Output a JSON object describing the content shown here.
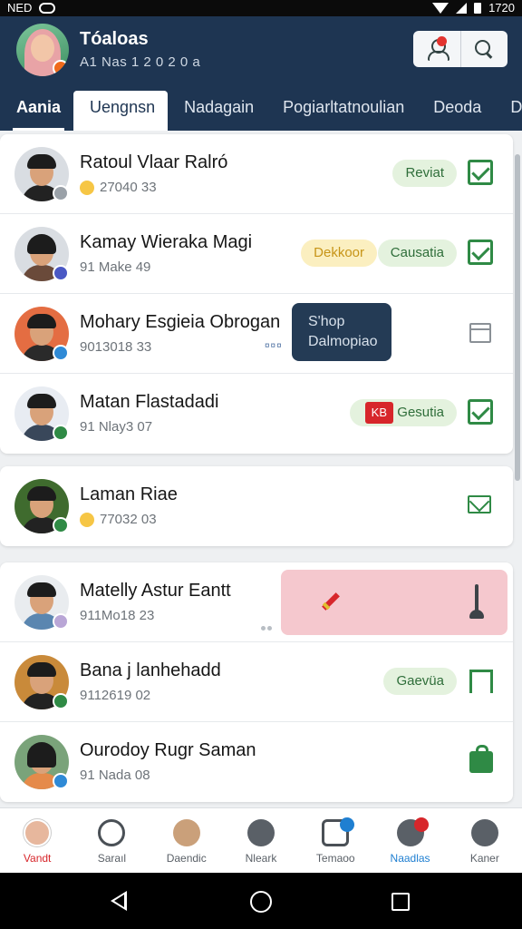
{
  "status_bar": {
    "left_text": "NED",
    "time": "1720"
  },
  "header": {
    "title": "Tóaloas",
    "subtitle": "A1 Nas 1 2 0 2 0 a",
    "tabs": [
      {
        "label": "Aania",
        "active": true
      },
      {
        "label": "Uengnsn",
        "selected": true
      },
      {
        "label": "Nadagain"
      },
      {
        "label": "Pogiarltatnoulian"
      },
      {
        "label": "Deoda"
      },
      {
        "label": "Dati"
      }
    ]
  },
  "tooltip": {
    "line1": "S'hop",
    "line2": "Dalmopiao",
    "mark": "¤¤¤"
  },
  "contacts_group_1": [
    {
      "name": "Ratoul Vlaar Ralró",
      "meta": "27040 33",
      "emoji": true,
      "chip": "Reviat",
      "badge_color": "#9aa1a8",
      "action": "check"
    },
    {
      "name": "Kamay Wieraka Magi",
      "meta": "91 Make 49",
      "chip_yellow": "Dekkoor",
      "chip": "Causatia",
      "badge_color": "#4a58c4",
      "action": "check"
    },
    {
      "name": "Mohary Esgieia Obrogan",
      "meta": "9013018 33",
      "badge_color": "#2f8ad6",
      "action": "box"
    },
    {
      "name": "Matan Flastadadi",
      "meta": "91 Nlay3 07",
      "chip_red": "KB",
      "chip": "Gesutia",
      "badge_color": "#2f8a45",
      "action": "check"
    }
  ],
  "contacts_group_2": [
    {
      "name": "Laman Riae",
      "meta": "77032 03",
      "emoji": true,
      "badge_color": "#2f8a45",
      "action": "mail"
    }
  ],
  "contacts_group_3": [
    {
      "name": "Matelly Astur Eantt",
      "meta": "911Mo18 23",
      "badge_color": "#b9a6d6",
      "action": "pink"
    },
    {
      "name": "Bana j lanhehadd",
      "meta": "9112619 02",
      "chip": "Gaevüa",
      "badge_color": "#2f8a45",
      "action": "halfbox"
    },
    {
      "name": "Ourodoy Rugr Saman",
      "meta": "91 Nada 08",
      "badge_color": "#2f8ad6",
      "action": "lock"
    }
  ],
  "bottom_nav": [
    {
      "label": "Vandt",
      "icon": "avatar-icon",
      "state": "active"
    },
    {
      "label": "Saraıl",
      "icon": "chat-bubble-icon"
    },
    {
      "label": "Daendic",
      "icon": "contact-photo-icon"
    },
    {
      "label": "Nleark",
      "icon": "check-circle-icon"
    },
    {
      "label": "Temaoo",
      "icon": "media-icon",
      "badge": "#1f7fd1"
    },
    {
      "label": "Naadlas",
      "icon": "gamepad-icon",
      "badge": "#d7262b",
      "state": "accent"
    },
    {
      "label": "Kaner",
      "icon": "person-icon"
    }
  ],
  "colors": {
    "header_bg": "#1e3552",
    "accent_green": "#2f8a45",
    "accent_red": "#d7262b"
  }
}
